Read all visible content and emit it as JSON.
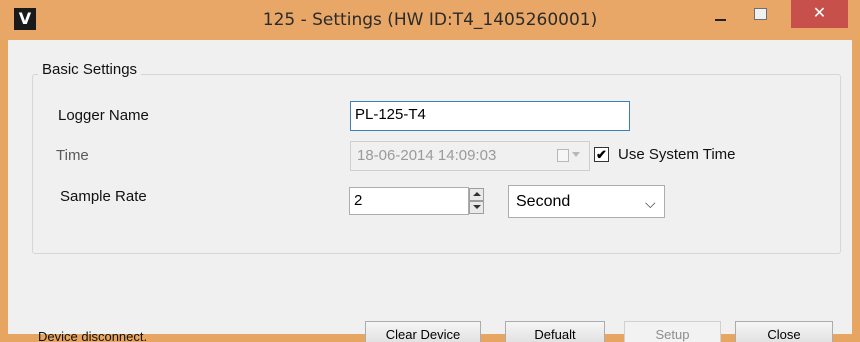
{
  "window": {
    "title": "125 - Settings (HW ID:T4_1405260001)",
    "app_icon_glyph": "V",
    "close_glyph": "✕"
  },
  "basic_settings": {
    "group_title": "Basic Settings",
    "logger_name": {
      "label": "Logger Name",
      "value": "PL-125-T4"
    },
    "time": {
      "label": "Time",
      "value": "18-06-2014 14:09:03"
    },
    "use_system_time": {
      "label": "Use System Time",
      "checked": true,
      "check_glyph": "✔"
    },
    "sample_rate": {
      "label": "Sample Rate",
      "value": "2",
      "unit": "Second"
    }
  },
  "status_text": "Device disconnect.",
  "buttons": {
    "clear_device": "Clear Device",
    "default": "Defualt",
    "setup": "Setup",
    "close": "Close"
  },
  "colors": {
    "frame": "#e8a766",
    "close_button": "#c7504a",
    "focus_border": "#3c7fb1"
  }
}
